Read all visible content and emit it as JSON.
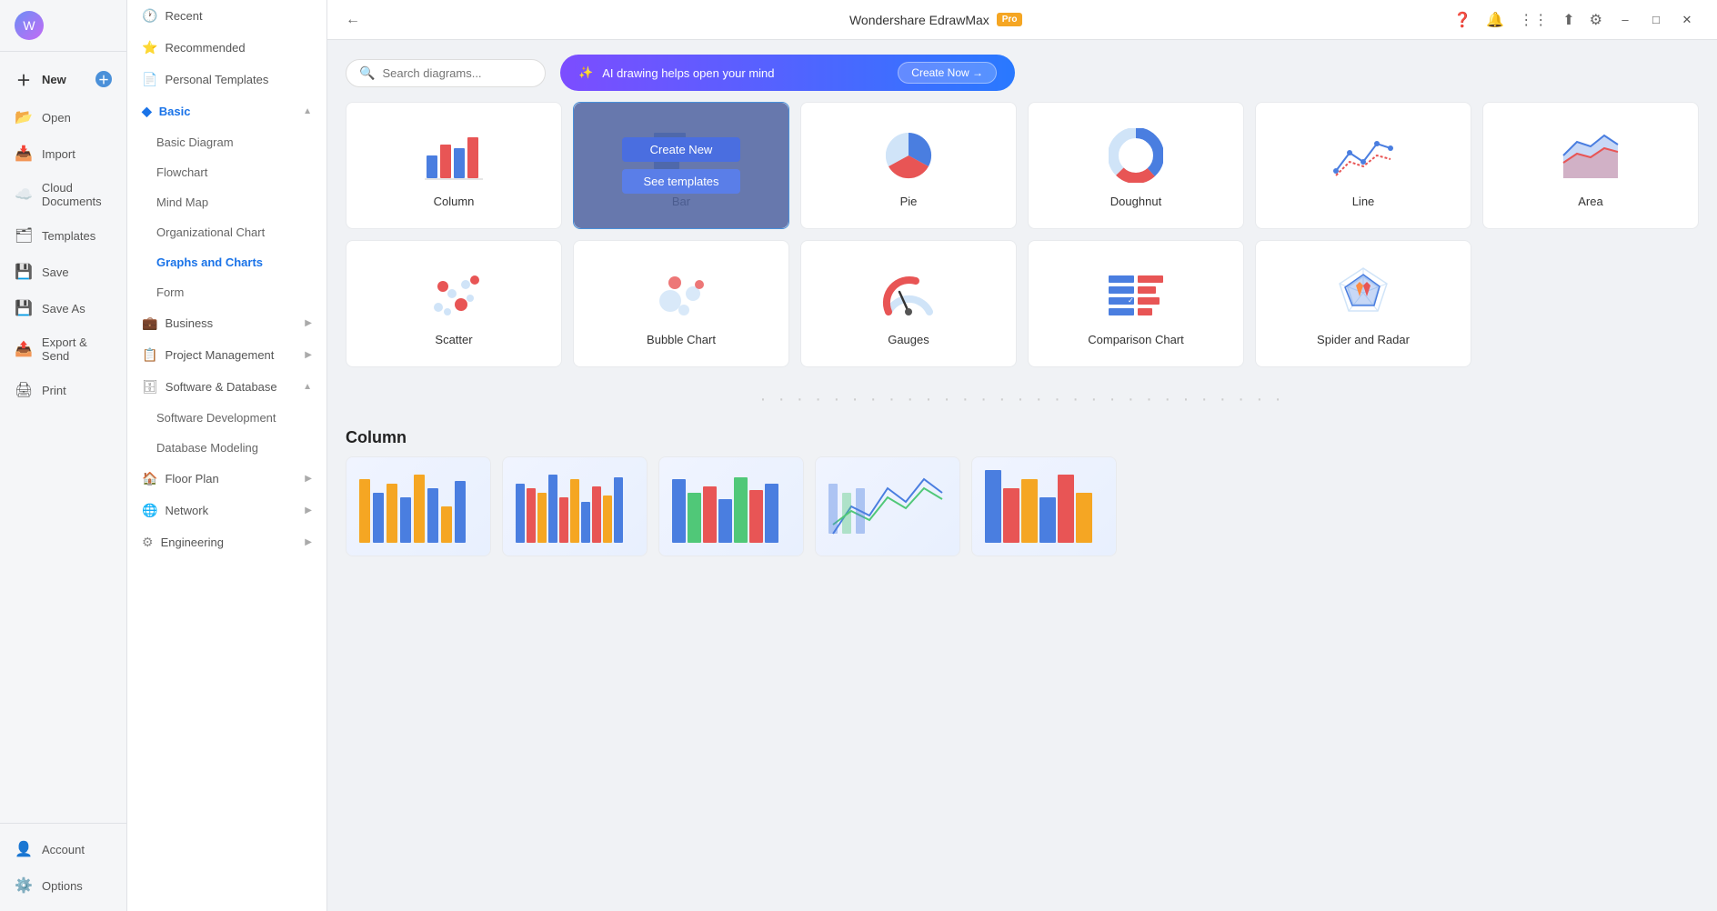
{
  "app": {
    "title": "Wondershare EdrawMax",
    "pro_badge": "Pro"
  },
  "sidebar": {
    "items": [
      {
        "id": "new",
        "label": "New",
        "icon": "➕"
      },
      {
        "id": "open",
        "label": "Open",
        "icon": "📂"
      },
      {
        "id": "import",
        "label": "Import",
        "icon": "📥"
      },
      {
        "id": "cloud",
        "label": "Cloud Documents",
        "icon": "☁️"
      },
      {
        "id": "templates",
        "label": "Templates",
        "icon": "🗂"
      },
      {
        "id": "save",
        "label": "Save",
        "icon": "💾"
      },
      {
        "id": "save-as",
        "label": "Save As",
        "icon": "💾"
      },
      {
        "id": "export",
        "label": "Export & Send",
        "icon": "📤"
      },
      {
        "id": "print",
        "label": "Print",
        "icon": "🖨"
      }
    ],
    "bottom_items": [
      {
        "id": "account",
        "label": "Account",
        "icon": "👤"
      },
      {
        "id": "options",
        "label": "Options",
        "icon": "⚙️"
      }
    ]
  },
  "nav_panel": {
    "quick_items": [
      {
        "label": "Recent",
        "icon": "🕐"
      },
      {
        "label": "Recommended",
        "icon": "⭐"
      },
      {
        "label": "Personal Templates",
        "icon": "📄"
      }
    ],
    "sections": [
      {
        "label": "Basic",
        "icon": "◇",
        "expanded": true,
        "active": true,
        "sub_items": [
          {
            "label": "Basic Diagram",
            "active": false
          },
          {
            "label": "Flowchart",
            "active": false
          },
          {
            "label": "Mind Map",
            "active": false
          },
          {
            "label": "Organizational Chart",
            "active": false
          },
          {
            "label": "Graphs and Charts",
            "active": true
          },
          {
            "label": "Form",
            "active": false
          }
        ]
      },
      {
        "label": "Business",
        "icon": "💼",
        "expanded": false
      },
      {
        "label": "Project Management",
        "icon": "📋",
        "expanded": false
      },
      {
        "label": "Software & Database",
        "icon": "🗄",
        "expanded": true,
        "sub_items": [
          {
            "label": "Software Development",
            "active": false
          },
          {
            "label": "Database Modeling",
            "active": false
          }
        ]
      },
      {
        "label": "Floor Plan",
        "icon": "🏠",
        "expanded": false
      },
      {
        "label": "Network",
        "icon": "🌐",
        "expanded": false
      },
      {
        "label": "Engineering",
        "icon": "⚙",
        "expanded": false
      }
    ]
  },
  "search": {
    "placeholder": "Search diagrams..."
  },
  "ai_banner": {
    "icon": "✨",
    "text": "AI drawing helps open your mind",
    "button_label": "Create Now →"
  },
  "chart_types": [
    {
      "id": "column",
      "label": "Column",
      "type": "column"
    },
    {
      "id": "bar",
      "label": "Bar",
      "type": "bar",
      "hovered": true
    },
    {
      "id": "pie",
      "label": "Pie",
      "type": "pie"
    },
    {
      "id": "doughnut",
      "label": "Doughnut",
      "type": "doughnut"
    },
    {
      "id": "line",
      "label": "Line",
      "type": "line"
    },
    {
      "id": "area",
      "label": "Area",
      "type": "area"
    },
    {
      "id": "scatter",
      "label": "Scatter",
      "type": "scatter"
    },
    {
      "id": "bubble",
      "label": "Bubble Chart",
      "type": "bubble"
    },
    {
      "id": "gauges",
      "label": "Gauges",
      "type": "gauges"
    },
    {
      "id": "comparison",
      "label": "Comparison Chart",
      "type": "comparison"
    },
    {
      "id": "spider",
      "label": "Spider and Radar",
      "type": "spider"
    }
  ],
  "overlay": {
    "create_new": "Create New",
    "see_templates": "See templates"
  },
  "section_label": "Column",
  "window_controls": {
    "minimize": "–",
    "maximize": "□",
    "close": "✕"
  }
}
